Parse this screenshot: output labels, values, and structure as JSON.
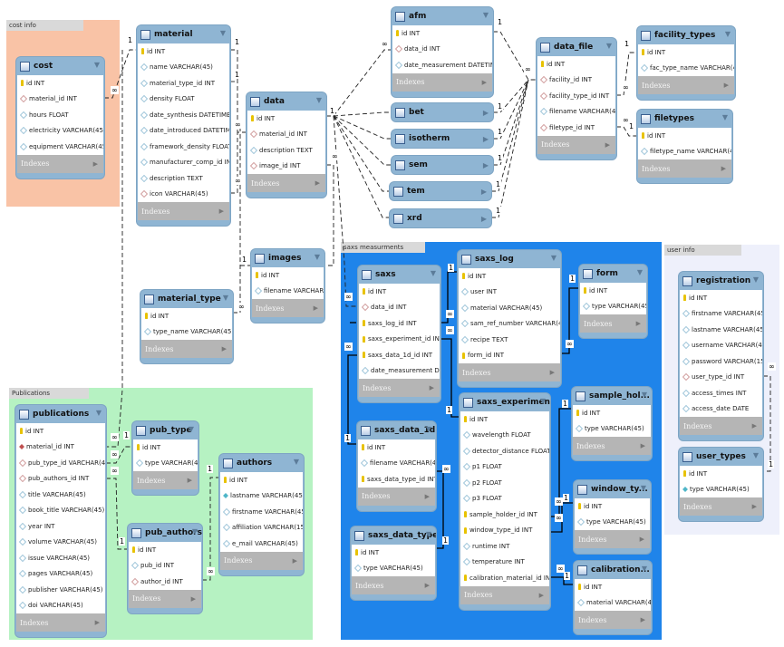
{
  "groups": [
    {
      "id": "cost_info",
      "label": "cost info",
      "color": "#f9c3a6"
    },
    {
      "id": "publications",
      "label": "Publications",
      "color": "#b6f2c2"
    },
    {
      "id": "saxs",
      "label": "saxs measurments",
      "color": "#1f84ea"
    },
    {
      "id": "user_info",
      "label": "user info",
      "color": "#eef0fb"
    }
  ],
  "indexes_label": "Indexes",
  "cardinality": {
    "one": "1",
    "many": "∞"
  },
  "tables": [
    {
      "id": "cost",
      "name": "cost",
      "columns": [
        [
          "pk",
          "id INT"
        ],
        [
          "fk",
          "material_id INT"
        ],
        [
          "col",
          "hours FLOAT"
        ],
        [
          "col",
          "electricity VARCHAR(45)"
        ],
        [
          "col",
          "equipment VARCHAR(45)"
        ]
      ]
    },
    {
      "id": "material",
      "name": "material",
      "columns": [
        [
          "pk",
          "id INT"
        ],
        [
          "col",
          "name VARCHAR(45)"
        ],
        [
          "col",
          "material_type_id INT"
        ],
        [
          "col",
          "density FLOAT"
        ],
        [
          "col",
          "date_synthesis DATETIME"
        ],
        [
          "col",
          "date_introduced DATETIME"
        ],
        [
          "col",
          "framework_density FLOAT"
        ],
        [
          "col",
          "manufacturer_comp_id INT"
        ],
        [
          "col",
          "description TEXT"
        ],
        [
          "fk",
          "icon VARCHAR(45)"
        ]
      ]
    },
    {
      "id": "data",
      "name": "data",
      "columns": [
        [
          "pk",
          "id INT"
        ],
        [
          "fk",
          "material_id INT"
        ],
        [
          "col",
          "description TEXT"
        ],
        [
          "fk",
          "image_id INT"
        ]
      ]
    },
    {
      "id": "images",
      "name": "images",
      "columns": [
        [
          "pk",
          "id INT"
        ],
        [
          "col",
          "filename VARCHAR..."
        ]
      ]
    },
    {
      "id": "material_type",
      "name": "material_type",
      "columns": [
        [
          "pk",
          "id INT"
        ],
        [
          "col",
          "type_name VARCHAR(45)"
        ]
      ]
    },
    {
      "id": "afm",
      "name": "afm",
      "columns": [
        [
          "pk",
          "id INT"
        ],
        [
          "fk",
          "data_id INT"
        ],
        [
          "col",
          "date_measurement DATETIME"
        ]
      ]
    },
    {
      "id": "bet",
      "name": "bet",
      "collapsed": true,
      "columns": []
    },
    {
      "id": "isotherm",
      "name": "isotherm",
      "collapsed": true,
      "columns": []
    },
    {
      "id": "sem",
      "name": "sem",
      "collapsed": true,
      "columns": []
    },
    {
      "id": "tem",
      "name": "tem",
      "collapsed": true,
      "columns": []
    },
    {
      "id": "xrd",
      "name": "xrd",
      "collapsed": true,
      "columns": []
    },
    {
      "id": "data_file",
      "name": "data_file",
      "columns": [
        [
          "pk",
          "id INT"
        ],
        [
          "fk",
          "facility_id INT"
        ],
        [
          "fk",
          "facility_type_id INT"
        ],
        [
          "col",
          "filename VARCHAR(45)"
        ],
        [
          "fk",
          "filetype_id INT"
        ]
      ]
    },
    {
      "id": "facility_types",
      "name": "facility_types",
      "columns": [
        [
          "pk",
          "id INT"
        ],
        [
          "col",
          "fac_type_name VARCHAR(45)"
        ]
      ]
    },
    {
      "id": "filetypes",
      "name": "filetypes",
      "columns": [
        [
          "pk",
          "id INT"
        ],
        [
          "col",
          "filetype_name VARCHAR(45)"
        ]
      ]
    },
    {
      "id": "publications",
      "name": "publications",
      "columns": [
        [
          "pk",
          "id INT"
        ],
        [
          "fkf",
          "material_id INT"
        ],
        [
          "fk",
          "pub_type_id VARCHAR(45)"
        ],
        [
          "fk",
          "pub_authors_id INT"
        ],
        [
          "col",
          "title VARCHAR(45)"
        ],
        [
          "col",
          "book_title VARCHAR(45)"
        ],
        [
          "col",
          "year INT"
        ],
        [
          "col",
          "volume VARCHAR(45)"
        ],
        [
          "col",
          "issue VARCHAR(45)"
        ],
        [
          "col",
          "pages VARCHAR(45)"
        ],
        [
          "col",
          "publisher VARCHAR(45)"
        ],
        [
          "col",
          "doi VARCHAR(45)"
        ]
      ]
    },
    {
      "id": "pub_type",
      "name": "pub_type",
      "columns": [
        [
          "pk",
          "id INT"
        ],
        [
          "col",
          "type VARCHAR(45)"
        ]
      ]
    },
    {
      "id": "authors",
      "name": "authors",
      "columns": [
        [
          "pk",
          "id INT"
        ],
        [
          "nn",
          "lastname VARCHAR(45)"
        ],
        [
          "col",
          "firstname VARCHAR(45)"
        ],
        [
          "col",
          "affiliation VARCHAR(150)"
        ],
        [
          "col",
          "e_mail VARCHAR(45)"
        ]
      ]
    },
    {
      "id": "pub_authors",
      "name": "pub_authors",
      "columns": [
        [
          "pk",
          "id INT"
        ],
        [
          "col",
          "pub_id INT"
        ],
        [
          "fk",
          "author_id INT"
        ]
      ]
    },
    {
      "id": "saxs",
      "name": "saxs",
      "columns": [
        [
          "pk",
          "id INT"
        ],
        [
          "fk",
          "data_id INT"
        ],
        [
          "pk",
          "saxs_log_id INT"
        ],
        [
          "pk",
          "saxs_experiment_id INT"
        ],
        [
          "pk",
          "saxs_data_1d_id INT"
        ],
        [
          "col",
          "date_measurement D..."
        ]
      ]
    },
    {
      "id": "saxs_log",
      "name": "saxs_log",
      "columns": [
        [
          "pk",
          "id INT"
        ],
        [
          "col",
          "user INT"
        ],
        [
          "col",
          "material VARCHAR(45)"
        ],
        [
          "col",
          "sam_ref_number VARCHAR(45)"
        ],
        [
          "col",
          "recipe TEXT"
        ],
        [
          "pk",
          "form_id INT"
        ]
      ]
    },
    {
      "id": "form",
      "name": "form",
      "columns": [
        [
          "pk",
          "id INT"
        ],
        [
          "col",
          "type VARCHAR(45)"
        ]
      ]
    },
    {
      "id": "saxs_experiment",
      "name": "saxs_experiment",
      "columns": [
        [
          "pk",
          "id INT"
        ],
        [
          "col",
          "wavelength FLOAT"
        ],
        [
          "col",
          "detector_distance FLOAT"
        ],
        [
          "col",
          "p1 FLOAT"
        ],
        [
          "col",
          "p2 FLOAT"
        ],
        [
          "col",
          "p3 FLOAT"
        ],
        [
          "pk",
          "sample_holder_id INT"
        ],
        [
          "pk",
          "window_type_id INT"
        ],
        [
          "col",
          "runtime INT"
        ],
        [
          "col",
          "temperature INT"
        ],
        [
          "pk",
          "calibration_material_id INT"
        ]
      ]
    },
    {
      "id": "sample_holder",
      "name": "sample_hol...",
      "columns": [
        [
          "pk",
          "id INT"
        ],
        [
          "col",
          "type VARCHAR(45)"
        ]
      ]
    },
    {
      "id": "window_type",
      "name": "window_ty...",
      "columns": [
        [
          "pk",
          "id INT"
        ],
        [
          "col",
          "type VARCHAR(45)"
        ]
      ]
    },
    {
      "id": "calibration",
      "name": "calibration...",
      "columns": [
        [
          "pk",
          "id INT"
        ],
        [
          "col",
          "material VARCHAR(45)"
        ]
      ]
    },
    {
      "id": "saxs_data_1d",
      "name": "saxs_data_1d",
      "columns": [
        [
          "pk",
          "id INT"
        ],
        [
          "col",
          "filename VARCHAR(45)"
        ],
        [
          "pk",
          "saxs_data_type_id INT"
        ]
      ]
    },
    {
      "id": "saxs_data_type",
      "name": "saxs_data_type",
      "columns": [
        [
          "pk",
          "id INT"
        ],
        [
          "col",
          "type VARCHAR(45)"
        ]
      ]
    },
    {
      "id": "registration",
      "name": "registration",
      "columns": [
        [
          "pk",
          "id INT"
        ],
        [
          "col",
          "firstname VARCHAR(45)"
        ],
        [
          "col",
          "lastname VARCHAR(45)"
        ],
        [
          "col",
          "username VARCHAR(45)"
        ],
        [
          "col",
          "password VARCHAR(15)"
        ],
        [
          "fk",
          "user_type_id INT"
        ],
        [
          "col",
          "access_times INT"
        ],
        [
          "col",
          "access_date DATE"
        ]
      ]
    },
    {
      "id": "user_types",
      "name": "user_types",
      "columns": [
        [
          "pk",
          "id INT"
        ],
        [
          "nn",
          "type VARCHAR(45)"
        ]
      ]
    }
  ]
}
